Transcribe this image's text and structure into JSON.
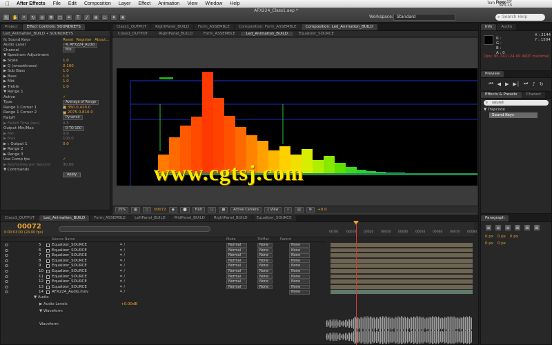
{
  "menubar": {
    "apple_icon": "apple-icon",
    "items": [
      "After Effects",
      "File",
      "Edit",
      "Composition",
      "Layer",
      "Effect",
      "Animation",
      "View",
      "Window",
      "Help"
    ],
    "user": "Tom Howe",
    "status_line1": "Power 59°",
    "status_line2": "66% 1.5"
  },
  "window": {
    "title": "AFX224_Class1.aep *",
    "workspace_label": "Workspace:",
    "workspace_value": "Standard",
    "search_placeholder": "Search Help"
  },
  "tools": [
    "arrow-tool-icon",
    "hand-tool-icon",
    "zoom-tool-icon",
    "rotate-tool-icon",
    "camera-tool-icon",
    "pan-tool-icon",
    "mask-tool-icon",
    "pen-tool-icon",
    "type-tool-icon",
    "brush-tool-icon",
    "clone-tool-icon",
    "eraser-tool-icon",
    "roto-tool-icon",
    "puppet-tool-icon"
  ],
  "effect_controls": {
    "tabs": [
      "Project",
      "Effect Controls: SOUNDKEYS"
    ],
    "subtitle": "Led_Animation_BUILD • SOUNDKEYS",
    "rows": [
      {
        "label": "fx Sound Keys",
        "value": "",
        "links": [
          "Reset",
          "Register",
          "About..."
        ]
      },
      {
        "label": "Audio Layer",
        "value": "",
        "select": "4. AFX224_Audio"
      },
      {
        "label": "Channel",
        "value": "",
        "select": "Mix"
      },
      {
        "label": "▼ Spectrum Adjustment",
        "value": ""
      },
      {
        "label": "▶ Scale",
        "value": "1.0"
      },
      {
        "label": "▶ Q (smoothness)",
        "value": "0.100"
      },
      {
        "label": "▶ Sub Bass",
        "value": "1.0"
      },
      {
        "label": "▶ Bass",
        "value": "1.0"
      },
      {
        "label": "▶ Mid",
        "value": "1.0"
      },
      {
        "label": "▶ Treble",
        "value": "1.0"
      },
      {
        "label": "▼ Range 1",
        "value": ""
      },
      {
        "label": "Active",
        "value": "✓"
      },
      {
        "label": "Type",
        "value": "",
        "select": "Average of Range"
      },
      {
        "label": "Range 1 Corner 1",
        "value": "350.0,420.0",
        "swatch": true
      },
      {
        "label": "Range 1 Corner 2",
        "value": "2075.0,810.0",
        "swatch": true
      },
      {
        "label": "Falloff",
        "value": "",
        "select": "Pyramid"
      },
      {
        "label": "▶ Falloff Time (sec)",
        "value": "0.5",
        "dim": true
      },
      {
        "label": "Output Min/Max",
        "value": "",
        "select": "0 TO 100"
      },
      {
        "label": "▶ Min",
        "value": "0.0",
        "dim": true
      },
      {
        "label": "▶ Max",
        "value": "100.0",
        "dim": true
      },
      {
        "label": "▶ ♭ Output 1",
        "value": "0.0"
      },
      {
        "label": "▶ Range 2",
        "value": ""
      },
      {
        "label": "▶ Range 3",
        "value": ""
      },
      {
        "label": "Use Comp fps",
        "value": "✓"
      },
      {
        "label": "▶ Keyframes per Second",
        "value": "30.00",
        "dim": true
      },
      {
        "label": "▼ Commands",
        "value": ""
      },
      {
        "label": "",
        "value": "",
        "button": "Apply"
      }
    ]
  },
  "composition": {
    "tabs": [
      "Class1_OUTPUT",
      "RightPanel_BUILD",
      "Form_ASSEMBLE",
      "Composition: Form_ASSEMBLE",
      "Composition: Led_Animation_BUILD"
    ],
    "crumbs": [
      "Class1_OUTPUT",
      "RightPanel_BUILD",
      "Form_ASSEMBLE",
      "Led_Animation_BUILD",
      "Equalizer_SOURCE"
    ],
    "footer": {
      "zoom": "25%",
      "timecode": "00072",
      "resolution": "Half",
      "camera": "Active Camera",
      "view": "1 View",
      "exposure": "+0.0"
    }
  },
  "watermark": "www.cgtsj.com",
  "info_panel": {
    "tabs": [
      "Info",
      "Audio"
    ],
    "r": "R :",
    "g": "G :",
    "b": "B :",
    "a": "A : 0",
    "x": "X : 2144",
    "y": "Y : 1504",
    "timing_line": "Dpx: 95.741 (24.00 INOT multime)"
  },
  "preview_panel": {
    "title": "Preview"
  },
  "effects_presets": {
    "tabs": [
      "Effects & Presets",
      "Charact"
    ],
    "search_value": "sound",
    "category": "▼ Trapcode",
    "item": "Sound Keys"
  },
  "paragraph_panel": {
    "title": "Paragraph",
    "rows": [
      {
        "a": "0 px",
        "b": "0 px",
        "c": "0 px"
      },
      {
        "a": "0 px",
        "b": "0 px"
      }
    ]
  },
  "timeline": {
    "tabs": [
      "Class1_OUTPUT",
      "Led_Animation_BUILD",
      "Form_ASSEMBLE",
      "LeftPanel_BUILD",
      "MidPanel_BUILD",
      "RightPanel_BUILD",
      "Equalizer_SOURCE"
    ],
    "timecode": "00072",
    "fps_line": "0:00:03:00 (24.00 fps)",
    "columns": {
      "name": "Source Name",
      "mode": "Mode",
      "trkmat": "TrkMat",
      "parent": "Parent"
    },
    "ruler_ticks": [
      "00:00",
      "00010",
      "00020",
      "00030",
      "00040",
      "00050",
      "00060",
      "00070",
      "00080"
    ],
    "layers": [
      {
        "num": "5",
        "name": "Equalizer_SOURCE",
        "mode": "Normal",
        "trk": "None",
        "parent": "None"
      },
      {
        "num": "6",
        "name": "Equalizer_SOURCE",
        "mode": "Normal",
        "trk": "None",
        "parent": "None"
      },
      {
        "num": "7",
        "name": "Equalizer_SOURCE",
        "mode": "Normal",
        "trk": "None",
        "parent": "None"
      },
      {
        "num": "8",
        "name": "Equalizer_SOURCE",
        "mode": "Normal",
        "trk": "None",
        "parent": "None"
      },
      {
        "num": "9",
        "name": "Equalizer_SOURCE",
        "mode": "Normal",
        "trk": "None",
        "parent": "None"
      },
      {
        "num": "10",
        "name": "Equalizer_SOURCE",
        "mode": "Normal",
        "trk": "None",
        "parent": "None"
      },
      {
        "num": "11",
        "name": "Equalizer_SOURCE",
        "mode": "Normal",
        "trk": "None",
        "parent": "None"
      },
      {
        "num": "12",
        "name": "Equalizer_SOURCE",
        "mode": "Normal",
        "trk": "None",
        "parent": "None"
      },
      {
        "num": "13",
        "name": "Equalizer_SOURCE",
        "mode": "Normal",
        "trk": "None",
        "parent": "None"
      },
      {
        "num": "14",
        "name": "AFX224_Audio.mov",
        "mode": "",
        "trk": "",
        "parent": "None"
      }
    ],
    "sub_rows": [
      {
        "label": "▼ Audio",
        "value": ""
      },
      {
        "label": "▶ Audio Levels",
        "value": "+0.00dB"
      },
      {
        "label": "▼ Waveform",
        "value": ""
      },
      {
        "label": "Waveform",
        "value": ""
      }
    ]
  },
  "colors": {
    "accent": "#e8a430",
    "playhead": "#d83a2a",
    "watermark": "#ffe800",
    "track": "#6d6552"
  }
}
